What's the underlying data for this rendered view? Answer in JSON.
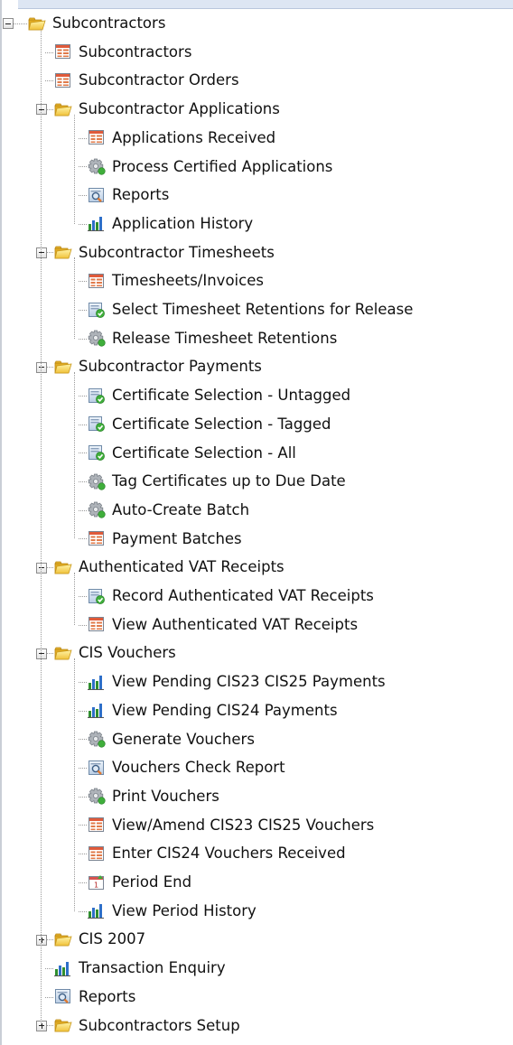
{
  "tree": [
    {
      "label": "Subcontractors",
      "icon": "folder-icon",
      "level": 0,
      "toggle": "minus",
      "last": false,
      "children": [
        {
          "label": "Subcontractors",
          "icon": "table-icon"
        },
        {
          "label": "Subcontractor Orders",
          "icon": "table-icon"
        },
        {
          "label": "Subcontractor Applications",
          "icon": "folder-icon",
          "toggle": "minus",
          "children": [
            {
              "label": "Applications Received",
              "icon": "table-icon"
            },
            {
              "label": "Process Certified Applications",
              "icon": "gear-icon"
            },
            {
              "label": "Reports",
              "icon": "report-icon"
            },
            {
              "label": "Application History",
              "icon": "bar-chart-icon"
            }
          ]
        },
        {
          "label": "Subcontractor Timesheets",
          "icon": "folder-icon",
          "toggle": "minus",
          "children": [
            {
              "label": "Timesheets/Invoices",
              "icon": "table-icon"
            },
            {
              "label": "Select Timesheet Retentions for Release",
              "icon": "select-check-icon"
            },
            {
              "label": "Release Timesheet Retentions",
              "icon": "gear-icon"
            }
          ]
        },
        {
          "label": "Subcontractor Payments",
          "icon": "folder-icon",
          "toggle": "minus",
          "children": [
            {
              "label": "Certificate Selection - Untagged",
              "icon": "select-check-icon"
            },
            {
              "label": "Certificate Selection - Tagged",
              "icon": "select-check-icon"
            },
            {
              "label": "Certificate Selection - All",
              "icon": "select-check-icon"
            },
            {
              "label": "Tag Certificates up to Due Date",
              "icon": "gear-icon"
            },
            {
              "label": "Auto-Create Batch",
              "icon": "gear-icon"
            },
            {
              "label": "Payment Batches",
              "icon": "table-icon"
            }
          ]
        },
        {
          "label": "Authenticated VAT Receipts",
          "icon": "folder-icon",
          "toggle": "minus",
          "children": [
            {
              "label": "Record Authenticated VAT Receipts",
              "icon": "select-check-icon"
            },
            {
              "label": "View Authenticated VAT Receipts",
              "icon": "table-icon"
            }
          ]
        },
        {
          "label": "CIS Vouchers",
          "icon": "folder-icon",
          "toggle": "minus",
          "children": [
            {
              "label": "View Pending CIS23  CIS25 Payments",
              "icon": "bar-chart-icon"
            },
            {
              "label": "View Pending CIS24 Payments",
              "icon": "bar-chart-icon"
            },
            {
              "label": "Generate Vouchers",
              "icon": "gear-icon"
            },
            {
              "label": "Vouchers Check Report",
              "icon": "report-icon"
            },
            {
              "label": "Print Vouchers",
              "icon": "gear-icon"
            },
            {
              "label": "View/Amend CIS23  CIS25 Vouchers",
              "icon": "table-icon"
            },
            {
              "label": "Enter CIS24 Vouchers Received",
              "icon": "table-icon"
            },
            {
              "label": "Period End",
              "icon": "calendar-icon"
            },
            {
              "label": "View Period History",
              "icon": "bar-chart-icon"
            }
          ]
        },
        {
          "label": "CIS 2007",
          "icon": "folder-icon",
          "toggle": "plus",
          "children": []
        },
        {
          "label": "Transaction Enquiry",
          "icon": "bar-chart-icon"
        },
        {
          "label": "Reports",
          "icon": "report-icon"
        },
        {
          "label": "Subcontractors Setup",
          "icon": "folder-icon",
          "toggle": "plus",
          "children": []
        }
      ]
    }
  ]
}
